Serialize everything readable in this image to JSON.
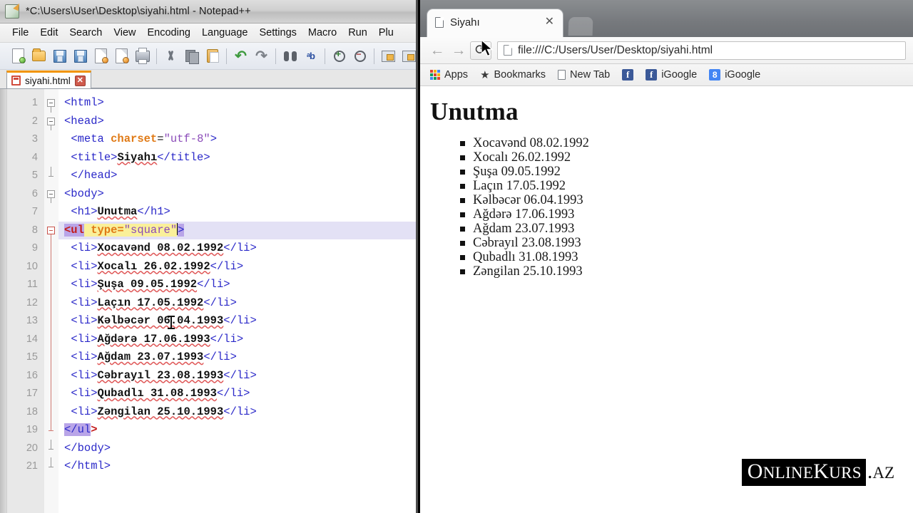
{
  "notepad": {
    "title": "*C:\\Users\\User\\Desktop\\siyahi.html - Notepad++",
    "menu": [
      "File",
      "Edit",
      "Search",
      "View",
      "Encoding",
      "Language",
      "Settings",
      "Macro",
      "Run",
      "Plu"
    ],
    "tab": {
      "label": "siyahi.html",
      "close": "✕"
    },
    "toolbar_icons": [
      "new-file-icon",
      "open-file-icon",
      "save-icon",
      "save-all-icon",
      "close-file-icon",
      "close-all-files-icon",
      "print-icon",
      "cut-icon",
      "copy-icon",
      "paste-icon",
      "undo-icon",
      "redo-icon",
      "find-icon",
      "replace-icon",
      "zoom-in-icon",
      "zoom-out-icon",
      "sync-view-icon"
    ],
    "code_lines": [
      {
        "n": 1,
        "fold": "start",
        "segments": [
          {
            "t": "tag",
            "v": "<html>"
          }
        ]
      },
      {
        "n": 2,
        "fold": "start",
        "segments": [
          {
            "t": "tag",
            "v": "<head>"
          }
        ]
      },
      {
        "n": 3,
        "fold": "none",
        "segments": [
          {
            "t": "plain",
            "v": " "
          },
          {
            "t": "tag",
            "v": "<meta "
          },
          {
            "t": "attr",
            "v": "charset"
          },
          {
            "t": "eq",
            "v": "="
          },
          {
            "t": "str",
            "v": "\"utf-8\""
          },
          {
            "t": "tag",
            "v": ">"
          }
        ]
      },
      {
        "n": 4,
        "fold": "none",
        "segments": [
          {
            "t": "plain",
            "v": " "
          },
          {
            "t": "tag",
            "v": "<title>"
          },
          {
            "t": "txt",
            "v": "Siyahı"
          },
          {
            "t": "tag",
            "v": "</title>"
          }
        ]
      },
      {
        "n": 5,
        "fold": "end",
        "segments": [
          {
            "t": "plain",
            "v": " "
          },
          {
            "t": "tag",
            "v": "</head>"
          }
        ]
      },
      {
        "n": 6,
        "fold": "start",
        "segments": [
          {
            "t": "tag",
            "v": "<body>"
          }
        ]
      },
      {
        "n": 7,
        "fold": "none",
        "segments": [
          {
            "t": "plain",
            "v": " "
          },
          {
            "t": "tag",
            "v": "<h1>"
          },
          {
            "t": "txt",
            "v": "Unutma"
          },
          {
            "t": "tag",
            "v": "</h1>"
          }
        ]
      },
      {
        "n": 8,
        "fold": "start-active",
        "highlight": true,
        "segments": [
          {
            "t": "hl-tag",
            "v": "<ul"
          },
          {
            "t": "hl-attr",
            "v": " type="
          },
          {
            "t": "hl-str",
            "v": "\"square\""
          },
          {
            "t": "caret",
            "v": ""
          },
          {
            "t": "hl-purple",
            "v": ">"
          }
        ]
      },
      {
        "n": 9,
        "fold": "bar",
        "segments": [
          {
            "t": "plain",
            "v": " "
          },
          {
            "t": "tag",
            "v": "<li>"
          },
          {
            "t": "txt",
            "v": "Xocavənd 08.02.1992"
          },
          {
            "t": "tag",
            "v": "</li>"
          }
        ]
      },
      {
        "n": 10,
        "fold": "bar",
        "segments": [
          {
            "t": "plain",
            "v": " "
          },
          {
            "t": "tag",
            "v": "<li>"
          },
          {
            "t": "txt",
            "v": "Xocalı 26.02.1992"
          },
          {
            "t": "tag",
            "v": "</li>"
          }
        ]
      },
      {
        "n": 11,
        "fold": "bar",
        "segments": [
          {
            "t": "plain",
            "v": " "
          },
          {
            "t": "tag",
            "v": "<li>"
          },
          {
            "t": "txt",
            "v": "Şuşa 09.05.1992"
          },
          {
            "t": "tag",
            "v": "</li>"
          }
        ]
      },
      {
        "n": 12,
        "fold": "bar",
        "segments": [
          {
            "t": "plain",
            "v": " "
          },
          {
            "t": "tag",
            "v": "<li>"
          },
          {
            "t": "txt",
            "v": "Laçın 17.05.1992"
          },
          {
            "t": "tag",
            "v": "</li>"
          }
        ]
      },
      {
        "n": 13,
        "fold": "bar",
        "segments": [
          {
            "t": "plain",
            "v": " "
          },
          {
            "t": "tag",
            "v": "<li>"
          },
          {
            "t": "txt",
            "v": "Kəlbəcər 06.04.1993"
          },
          {
            "t": "tag",
            "v": "</li>"
          }
        ]
      },
      {
        "n": 14,
        "fold": "bar",
        "segments": [
          {
            "t": "plain",
            "v": " "
          },
          {
            "t": "tag",
            "v": "<li>"
          },
          {
            "t": "txt",
            "v": "Ağdərə 17.06.1993"
          },
          {
            "t": "tag",
            "v": "</li>"
          }
        ]
      },
      {
        "n": 15,
        "fold": "bar",
        "segments": [
          {
            "t": "plain",
            "v": " "
          },
          {
            "t": "tag",
            "v": "<li>"
          },
          {
            "t": "txt",
            "v": "Ağdam 23.07.1993"
          },
          {
            "t": "tag",
            "v": "</li>"
          }
        ]
      },
      {
        "n": 16,
        "fold": "bar",
        "segments": [
          {
            "t": "plain",
            "v": " "
          },
          {
            "t": "tag",
            "v": "<li>"
          },
          {
            "t": "txt",
            "v": "Cəbrayıl 23.08.1993"
          },
          {
            "t": "tag",
            "v": "</li>"
          }
        ]
      },
      {
        "n": 17,
        "fold": "bar",
        "segments": [
          {
            "t": "plain",
            "v": " "
          },
          {
            "t": "tag",
            "v": "<li>"
          },
          {
            "t": "txt",
            "v": "Qubadlı 31.08.1993"
          },
          {
            "t": "tag",
            "v": "</li>"
          }
        ]
      },
      {
        "n": 18,
        "fold": "bar",
        "segments": [
          {
            "t": "plain",
            "v": " "
          },
          {
            "t": "tag",
            "v": "<li>"
          },
          {
            "t": "txt",
            "v": "Zəngilan 25.10.1993"
          },
          {
            "t": "tag",
            "v": "</li>"
          }
        ]
      },
      {
        "n": 19,
        "fold": "end-active",
        "segments": [
          {
            "t": "hl-purple",
            "v": "</ul"
          },
          {
            "t": "tag-red",
            "v": ">"
          }
        ]
      },
      {
        "n": 20,
        "fold": "end",
        "segments": [
          {
            "t": "tag",
            "v": "</body>"
          }
        ]
      },
      {
        "n": 21,
        "fold": "end",
        "segments": [
          {
            "t": "tag",
            "v": "</html>"
          }
        ]
      }
    ]
  },
  "browser": {
    "tab": {
      "title": "Siyahı",
      "close_label": "✕",
      "icon": "page-icon"
    },
    "nav": {
      "back": "←",
      "forward": "→",
      "reload": "⟳"
    },
    "omnibox": {
      "url": "file:///C:/Users/User/Desktop/siyahi.html",
      "icon": "page-icon"
    },
    "bookmarks": [
      {
        "label": "Apps",
        "icon": "apps-grid-icon"
      },
      {
        "label": "Bookmarks",
        "icon": "star-icon"
      },
      {
        "label": "New Tab",
        "icon": "page-icon"
      },
      {
        "label": "",
        "icon": "facebook-icon",
        "glyph": "f"
      },
      {
        "label": "iGoogle",
        "icon": "facebook-icon",
        "glyph": "f"
      },
      {
        "label": "iGoogle",
        "icon": "google-icon",
        "glyph": "8"
      }
    ],
    "page": {
      "heading": "Unutma",
      "list_type": "square",
      "items": [
        "Xocavənd 08.02.1992",
        "Xocalı 26.02.1992",
        "Şuşa 09.05.1992",
        "Laçın 17.05.1992",
        "Kəlbəcər 06.04.1993",
        "Ağdərə 17.06.1993",
        "Ağdam 23.07.1993",
        "Cəbrayıl 23.08.1993",
        "Qubadlı 31.08.1993",
        "Zəngilan 25.10.1993"
      ]
    },
    "watermark": {
      "dark": "OɴʟɪɴᴇKᴜʀs",
      "light": ".ᴀz",
      "dark_plain": "ONLINEKURS",
      "light_plain": ".AZ"
    }
  },
  "colors": {
    "tab_accent": "#f29400",
    "tag_blue": "#2b29c9",
    "attr_orange": "#e07a16",
    "string_purple": "#8a4ab8",
    "highlight_purple": "#b9a5e8",
    "attr_highlight_yellow": "#faf09a",
    "fold_active_red": "#c9524a",
    "facebook_blue": "#3b5998",
    "google_blue": "#4285f4"
  }
}
